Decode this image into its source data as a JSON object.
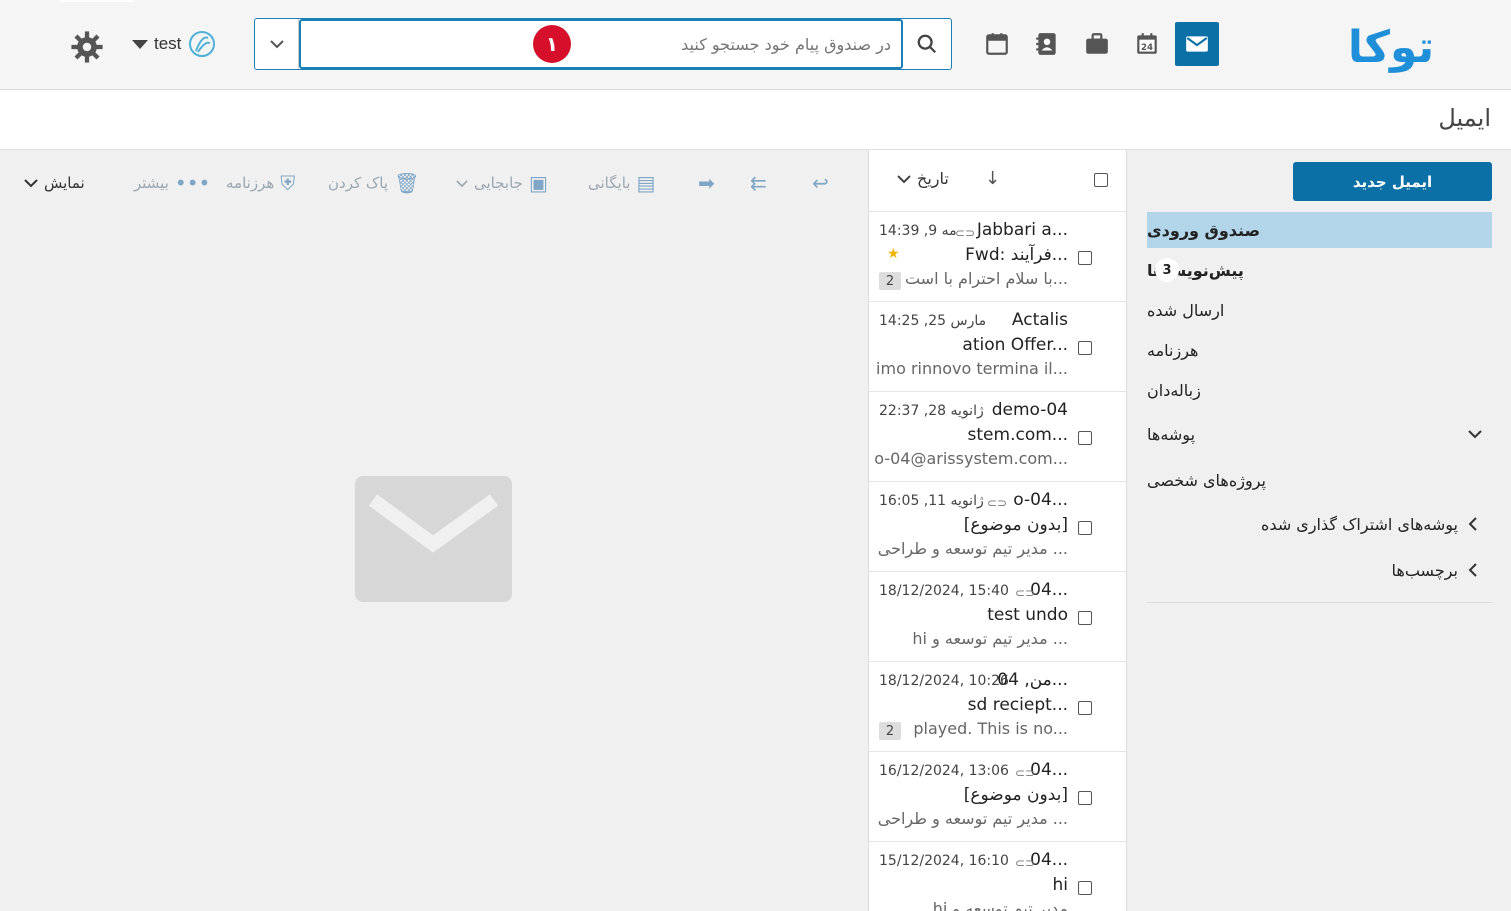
{
  "header": {
    "logo_text": "توکا",
    "search": {
      "placeholder": "در صندوق پیام خود جستجو کنید",
      "value": "در صندوق پیام خود جستجو کنید",
      "marker": "۱"
    },
    "user": {
      "name": "test"
    },
    "apps": [
      "mail-icon",
      "calendar-24-icon",
      "briefcase-icon",
      "contacts-icon",
      "calendar-icon"
    ]
  },
  "page": {
    "title": "ایمیل"
  },
  "sidebar": {
    "new_email": "ایمیل جدید",
    "folders": [
      {
        "label": "صندوق ورودی",
        "active": true
      },
      {
        "label": "پیش‌نویس‌ها",
        "count": "3"
      },
      {
        "label": "ارسال شده"
      },
      {
        "label": "هرزنامه"
      },
      {
        "label": "زباله‌دان"
      },
      {
        "label": "پوشه‌ها"
      },
      {
        "label": "پروژه‌های شخصی"
      },
      {
        "label": "پوشه‌های اشتراک گذاری شده"
      },
      {
        "label": "برچسب‌ها"
      }
    ]
  },
  "list": {
    "sort_label": "تاریخ",
    "messages": [
      {
        "from": "Jabbari a...",
        "date": "مه 9, 14:39",
        "subject": "Fwd: فرآیند...",
        "preview": "با سلام احترام  با است...",
        "thread": "2",
        "starred": true,
        "clip": true
      },
      {
        "from": "Actalis",
        "date": "مارس 25, 14:25",
        "subject": "ation Offer...",
        "preview": "imo rinnovo termina il...",
        "thread": "",
        "starred": false,
        "clip": false
      },
      {
        "from": "demo-04",
        "date": "ژانویه 28, 22:37",
        "subject": "stem.com...",
        "preview": "o-04@arissystem.com...",
        "thread": "",
        "starred": false,
        "clip": false
      },
      {
        "from": "o-04...",
        "date": "ژانویه 11, 16:05",
        "subject": "[بدون موضوع]",
        "preview": "مدیر تیم توسعه و طراحی ...",
        "thread": "",
        "starred": false,
        "clip": true
      },
      {
        "from": "04...",
        "date": "18/12/2024, 15:40",
        "subject": "test undo",
        "preview": "hi        مدیر تیم توسعه و ...",
        "thread": "",
        "starred": false,
        "clip": true
      },
      {
        "from": "من, 04...",
        "date": "18/12/2024, 10:26",
        "subject": "sd reciept...",
        "preview": "played. This is no...",
        "thread": "2",
        "starred": false,
        "clip": false
      },
      {
        "from": "04...",
        "date": "16/12/2024, 13:06",
        "subject": "[بدون موضوع]",
        "preview": "مدیر تیم توسعه و طراحی ...",
        "thread": "",
        "starred": false,
        "clip": true
      },
      {
        "from": "04...",
        "date": "15/12/2024, 16:10",
        "subject": "hi",
        "preview": "hi        مدیر تیم توسعه و",
        "thread": "",
        "starred": false,
        "clip": true
      }
    ]
  },
  "toolbar": {
    "archive": "بایگانی",
    "move": "جابجایی",
    "delete": "پاک کردن",
    "spam": "هرزنامه",
    "more": "بیشتر",
    "view": "نمایش"
  }
}
